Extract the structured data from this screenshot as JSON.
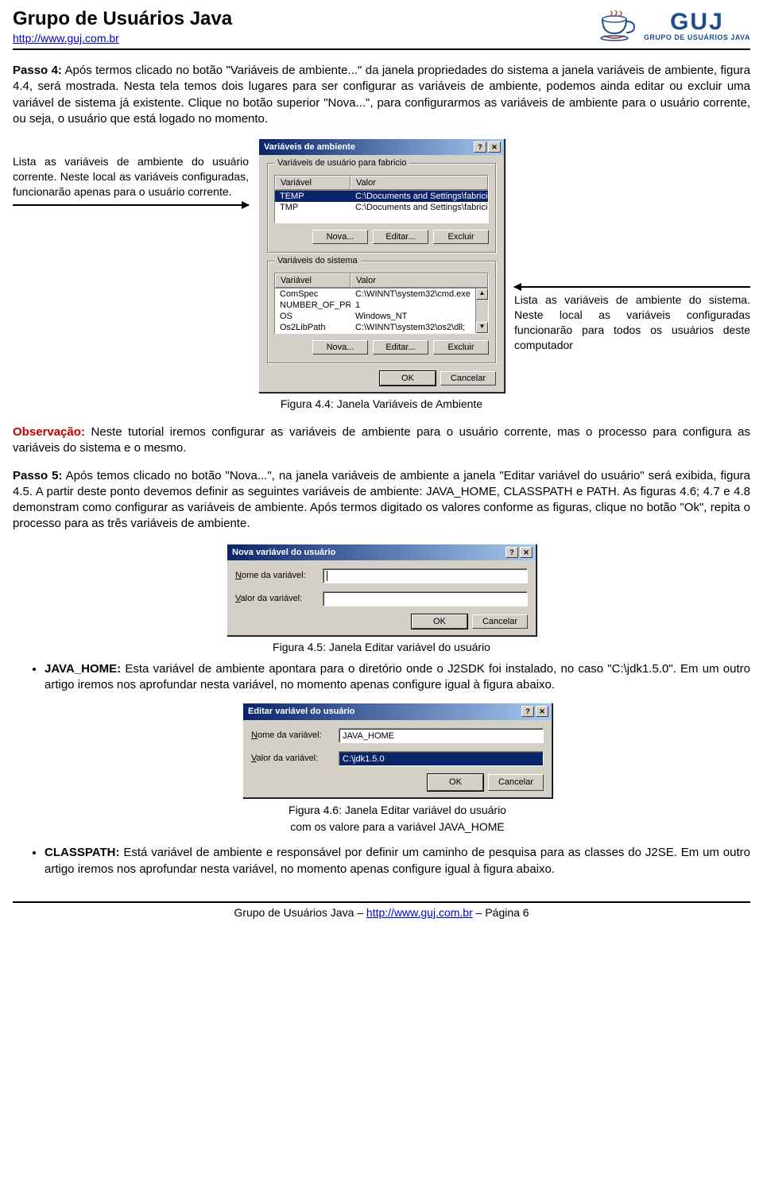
{
  "header": {
    "title": "Grupo de Usuários Java",
    "url": "http://www.guj.com.br",
    "logo_big": "GUJ",
    "logo_small": "GRUPO DE USUÁRIOS JAVA"
  },
  "passo4": {
    "lead": "Passo 4:",
    "text": " Após termos clicado no botão \"Variáveis de ambiente...\" da janela propriedades do sistema a janela variáveis de ambiente, figura 4.4, será mostrada. Nesta tela temos dois lugares para ser configurar as variáveis de ambiente, podemos ainda editar ou excluir uma variável de sistema já existente. Clique no botão superior \"Nova...\", para configurarmos as variáveis de ambiente para o usuário corrente, ou seja, o usuário que está logado no momento."
  },
  "left_note": "Lista as variáveis de ambiente do usuário corrente. Neste local as variáveis configuradas, funcionarão apenas para o usuário corrente.",
  "right_note": "Lista as variáveis de ambiente do sistema. Neste local as variáveis configuradas funcionarão para todos os usuários deste computador",
  "env_dialog": {
    "title": "Variáveis de ambiente",
    "group1_title": "Variáveis de usuário para fabricio",
    "group2_title": "Variáveis do sistema",
    "col_var": "Variável",
    "col_val": "Valor",
    "user_rows": [
      {
        "var": "TEMP",
        "val": "C:\\Documents and Settings\\fabricio\\Con..."
      },
      {
        "var": "TMP",
        "val": "C:\\Documents and Settings\\fabricio\\Con..."
      }
    ],
    "sys_rows": [
      {
        "var": "ComSpec",
        "val": "C:\\WINNT\\system32\\cmd.exe"
      },
      {
        "var": "NUMBER_OF_PR...",
        "val": "1"
      },
      {
        "var": "OS",
        "val": "Windows_NT"
      },
      {
        "var": "Os2LibPath",
        "val": "C:\\WINNT\\system32\\os2\\dll;"
      }
    ],
    "btn_nova": "Nova...",
    "btn_editar": "Editar...",
    "btn_excluir": "Excluir",
    "btn_ok": "OK",
    "btn_cancel": "Cancelar"
  },
  "fig44": "Figura 4.4: Janela Variáveis de Ambiente",
  "obs_lead": "Observação:",
  "obs_text": " Neste tutorial iremos configurar as variáveis de ambiente para o usuário corrente, mas o processo para configura as variáveis do sistema e o mesmo.",
  "passo5": {
    "lead": "Passo 5:",
    "text": " Após temos clicado no botão \"Nova...\", na janela variáveis de ambiente a janela \"Editar variável do usuário\" será exibida, figura 4.5. A partir deste ponto devemos definir as seguintes variáveis de ambiente: JAVA_HOME, CLASSPATH e PATH. As figuras 4.6; 4.7 e 4.8 demonstram como configurar as variáveis de ambiente. Após termos digitado os valores conforme as figuras, clique no botão \"Ok\", repita o processo para as três variáveis de ambiente."
  },
  "new_dialog": {
    "title": "Nova variável do usuário",
    "lbl_nome": "Nome da variável:",
    "lbl_valor": "Valor da variável:",
    "val_nome": "",
    "val_valor": "",
    "btn_ok": "OK",
    "btn_cancel": "Cancelar"
  },
  "fig45": "Figura 4.5: Janela Editar variável do usuário",
  "bullets": {
    "java_home_lead": "JAVA_HOME:",
    "java_home_text": " Esta variável de ambiente apontara para o diretório onde o J2SDK foi instalado, no caso \"C:\\jdk1.5.0\". Em um outro artigo iremos nos aprofundar nesta variável, no momento apenas configure igual à figura abaixo.",
    "classpath_lead": "CLASSPATH:",
    "classpath_text": " Está variável de ambiente e responsável por definir um caminho de pesquisa para as classes do J2SE. Em um outro artigo iremos nos aprofundar nesta variável, no momento apenas configure igual à figura abaixo."
  },
  "edit_dialog": {
    "title": "Editar variável do usuário",
    "lbl_nome": "Nome da variável:",
    "lbl_valor": "Valor da variável:",
    "val_nome": "JAVA_HOME",
    "val_valor": "C:\\jdk1.5.0",
    "btn_ok": "OK",
    "btn_cancel": "Cancelar"
  },
  "fig46_a": "Figura 4.6: Janela Editar variável do usuário",
  "fig46_b": "com os valore para a variável JAVA_HOME",
  "footer": {
    "left": "Grupo de Usuários Java – ",
    "url": "http://www.guj.com.br",
    "right": " – Página 6"
  }
}
